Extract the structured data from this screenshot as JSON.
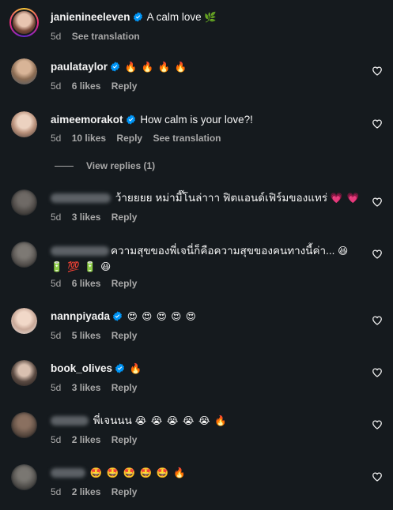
{
  "caption": {
    "username": "janienineeleven",
    "text": "A calm love",
    "emoji": "🌿",
    "time": "5d",
    "see_translation": "See translation"
  },
  "comments": [
    {
      "username": "paulataylor",
      "verified": true,
      "text": "",
      "emoji": "🔥 🔥 🔥 🔥",
      "time": "5d",
      "likes": "6 likes",
      "reply": "Reply"
    },
    {
      "username": "aimeemorakot",
      "verified": true,
      "text": "How calm is your love?!",
      "emoji": "",
      "time": "5d",
      "likes": "10 likes",
      "reply": "Reply",
      "see_translation": "See translation",
      "view_replies": "View replies (1)"
    },
    {
      "username": "",
      "verified": false,
      "text": "ว้ายยยย หม่ามี๊โนล่าาา ฟิตแอนด์เฟิร์มของแทร่",
      "emoji": "💗 💗",
      "time": "5d",
      "likes": "3 likes",
      "reply": "Reply"
    },
    {
      "username": "",
      "verified": false,
      "text": "ความสุขของพี่เจนี่ก็คือความสุขของคนทางนี้ค่า...",
      "emoji": "😆 🔋 💯 🔋 😆",
      "time": "5d",
      "likes": "6 likes",
      "reply": "Reply"
    },
    {
      "username": "nannpiyada",
      "verified": true,
      "text": "",
      "emoji": "😍 😍 😍 😍 😍",
      "time": "5d",
      "likes": "5 likes",
      "reply": "Reply"
    },
    {
      "username": "book_olives",
      "verified": true,
      "text": "",
      "emoji": "🔥",
      "time": "5d",
      "likes": "3 likes",
      "reply": "Reply"
    },
    {
      "username": "",
      "verified": false,
      "text": "พี่เจนนน",
      "emoji": "😭 😭 😭 😭 😭 🔥",
      "time": "5d",
      "likes": "2 likes",
      "reply": "Reply"
    },
    {
      "username": "",
      "verified": false,
      "text": "",
      "emoji": "🤩 🤩 🤩 🤩 🤩 🔥",
      "time": "5d",
      "likes": "2 likes",
      "reply": "Reply"
    }
  ],
  "colors": {
    "background": "#151a1e",
    "text": "#f5f5f5",
    "muted": "#a8a8a8",
    "verified_blue": "#0095f6"
  },
  "icons": {
    "verified": "verified-badge-icon",
    "like": "heart-outline-icon"
  }
}
